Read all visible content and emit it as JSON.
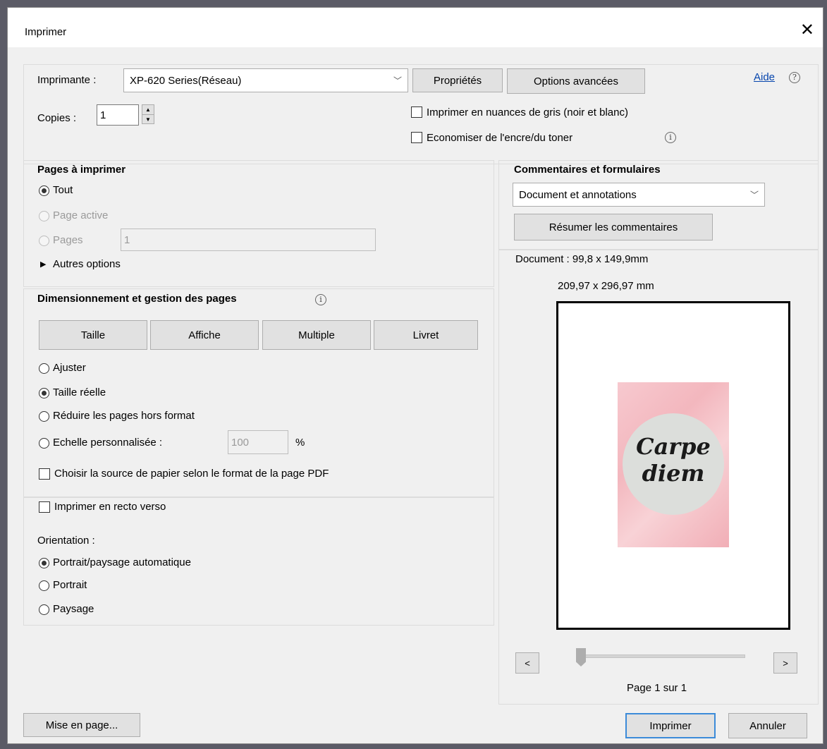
{
  "window": {
    "title": "Imprimer",
    "close_label": "✕"
  },
  "printer": {
    "label": "Imprimante :",
    "selected": "XP-620 Series(Réseau)",
    "properties_button": "Propriétés",
    "advanced_button": "Options avancées",
    "help_link": "Aide",
    "copies_label": "Copies :",
    "copies_value": "1",
    "grayscale_label": "Imprimer en nuances de gris (noir et blanc)",
    "save_ink_label": "Economiser de l'encre/du toner"
  },
  "pages": {
    "heading": "Pages à imprimer",
    "all_label": "Tout",
    "active_label": "Page active",
    "pages_label": "Pages",
    "pages_value": "1",
    "more_options_label": "Autres options"
  },
  "sizing": {
    "heading": "Dimensionnement et gestion des pages",
    "tabs": [
      "Taille",
      "Affiche",
      "Multiple",
      "Livret"
    ],
    "fit_label": "Ajuster",
    "actual_size_label": "Taille réelle",
    "shrink_label": "Réduire les pages hors format",
    "custom_scale_label": "Echelle personnalisée :",
    "custom_scale_value": "100",
    "percent_label": "%",
    "paper_source_label": "Choisir la source de papier selon le format de la page PDF"
  },
  "duplex": {
    "duplex_label": "Imprimer en recto verso",
    "orientation_label": "Orientation :",
    "auto_label": "Portrait/paysage automatique",
    "portrait_label": "Portrait",
    "landscape_label": "Paysage"
  },
  "comments": {
    "heading": "Commentaires et formulaires",
    "selected": "Document et annotations",
    "summarize_button": "Résumer les commentaires"
  },
  "preview": {
    "document_size": "Document : 99,8 x 149,9mm",
    "paper_size": "209,97 x 296,97 mm",
    "image_text_line1": "Carpe",
    "image_text_line2": "diem",
    "prev_label": "<",
    "next_label": ">",
    "page_indicator": "Page 1 sur 1"
  },
  "footer": {
    "page_setup_button": "Mise en page...",
    "print_button": "Imprimer",
    "cancel_button": "Annuler"
  }
}
